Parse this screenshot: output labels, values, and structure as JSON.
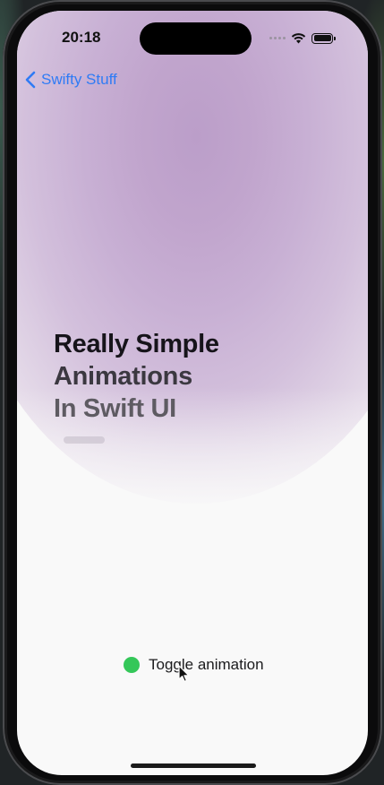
{
  "status_bar": {
    "time": "20:18"
  },
  "nav": {
    "back_label": "Swifty Stuff"
  },
  "title": {
    "line1": "Really Simple",
    "line2": "Animations",
    "line3": "In Swift UI"
  },
  "toggle": {
    "label": "Toggle animation",
    "state_color": "#34c759"
  },
  "colors": {
    "accent": "#2f7bf5",
    "header_tint": "#bb9ec9"
  },
  "icons": {
    "back": "chevron-left-icon",
    "wifi": "wifi-icon",
    "battery": "battery-icon",
    "signal": "cellular-signal-icon"
  }
}
